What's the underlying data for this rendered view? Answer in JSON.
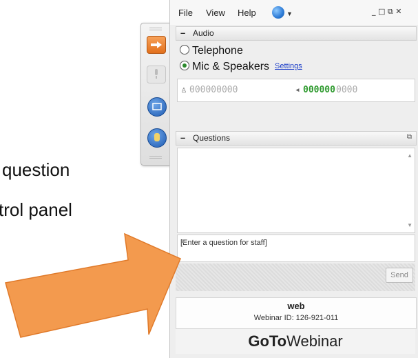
{
  "caption": {
    "line1": "question",
    "line2": "trol panel"
  },
  "menubar": {
    "file": "File",
    "view": "View",
    "help": "Help",
    "win_controls": "_ □ ⧉ ✕"
  },
  "audio": {
    "header": "Audio",
    "header_toggle": "–",
    "telephone_label": "Telephone",
    "mic_label": "Mic & Speakers",
    "settings_link": "Settings",
    "mic_meter": "000000000",
    "speaker_meter_on": "000000",
    "speaker_meter_off": "0000"
  },
  "questions": {
    "header": "Questions",
    "header_toggle": "–",
    "input_placeholder": "[Enter a question for staff]",
    "send_label": "Send"
  },
  "webinar": {
    "name": "web",
    "id_text": "Webinar ID: 126-921-011",
    "brand_bold": "GoTo",
    "brand_rest": "Webinar"
  },
  "colors": {
    "arrow": "#f39a4e",
    "accent": "#e2701c",
    "meter_active": "#2e9a2e"
  }
}
